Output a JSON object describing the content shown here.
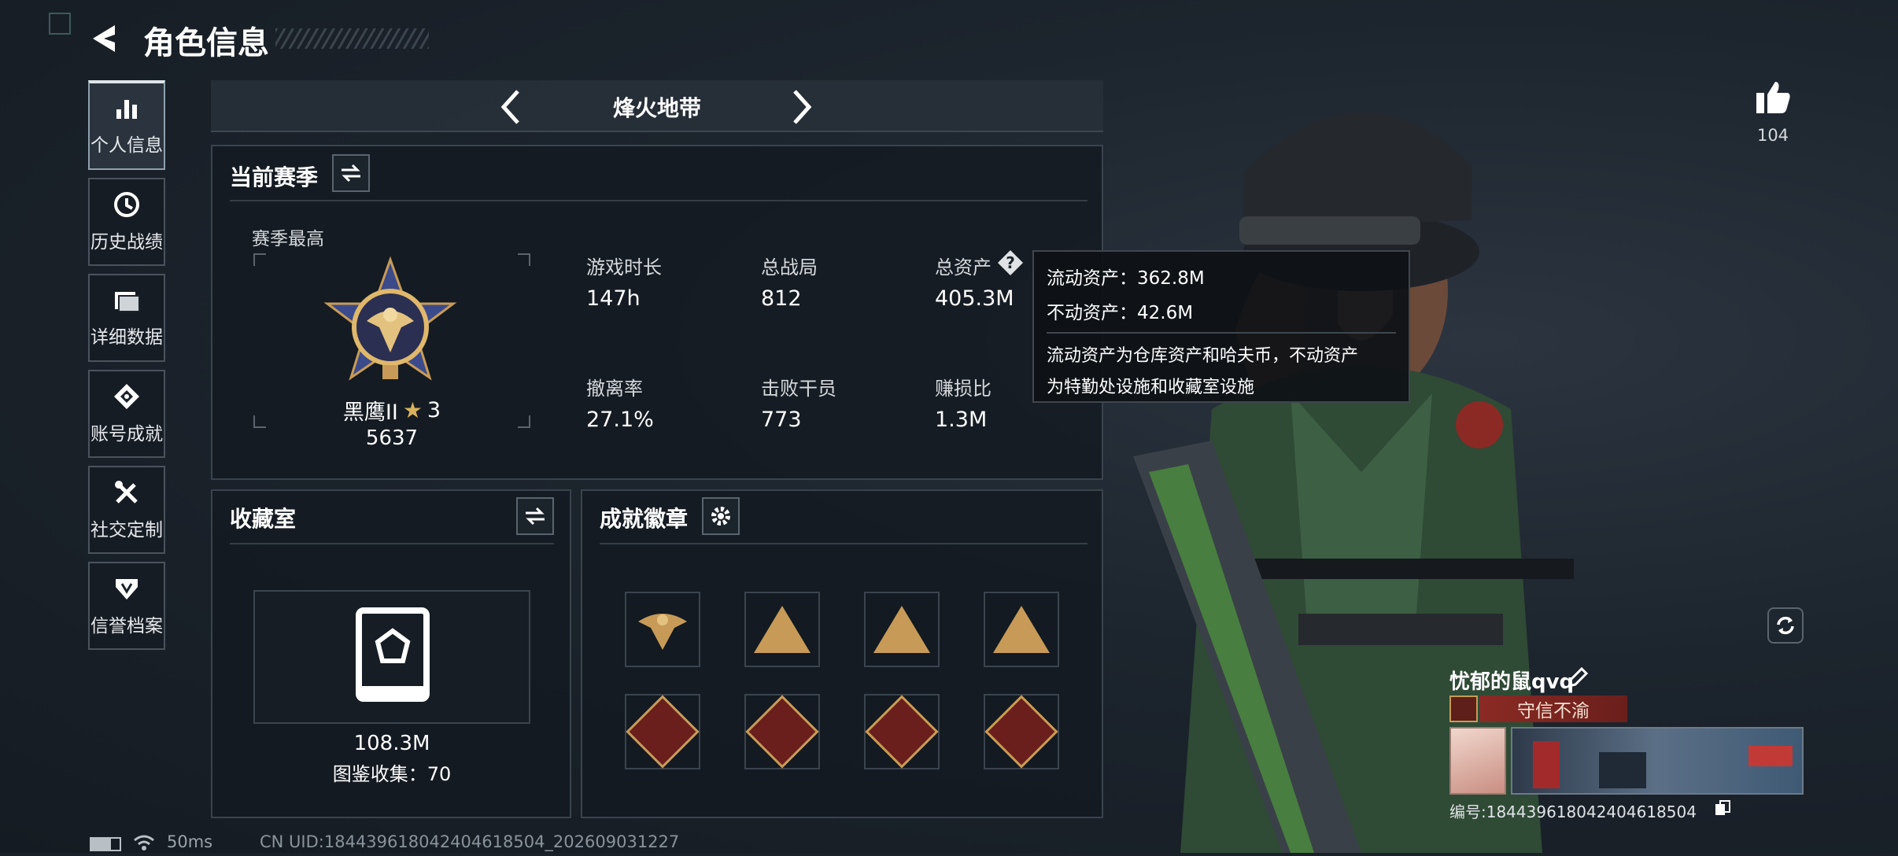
{
  "header": {
    "title": "角色信息"
  },
  "sidebar": {
    "items": [
      {
        "label": "个人信息",
        "icon": "bar-chart-icon"
      },
      {
        "label": "历史战绩",
        "icon": "history-icon"
      },
      {
        "label": "详细数据",
        "icon": "folder-icon"
      },
      {
        "label": "账号成就",
        "icon": "achievement-icon"
      },
      {
        "label": "社交定制",
        "icon": "tools-icon"
      },
      {
        "label": "信誉档案",
        "icon": "credit-icon"
      }
    ]
  },
  "mode_tabs": {
    "current": "烽火地带"
  },
  "season": {
    "title": "当前赛季",
    "best_label": "赛季最高",
    "rank_name": "黑鹰II",
    "rank_stars": "3",
    "rank_score": "5637",
    "stats": [
      {
        "label": "游戏时长",
        "value": "147h"
      },
      {
        "label": "总战局",
        "value": "812"
      },
      {
        "label": "总资产",
        "value": "405.3M"
      },
      {
        "label": "撤离率",
        "value": "27.1%"
      },
      {
        "label": "击败干员",
        "value": "773"
      },
      {
        "label": "赚损比",
        "value": "1.3M"
      }
    ]
  },
  "tooltip": {
    "liquid": "流动资产：362.8M",
    "fixed": "不动资产：42.6M",
    "desc_line1": "流动资产为仓库资产和哈夫币，不动资产",
    "desc_line2": "为特勤处设施和收藏室设施"
  },
  "collection": {
    "title": "收藏室",
    "value": "108.3M",
    "count_text": "图鉴收集：70"
  },
  "achievements": {
    "title": "成就徽章",
    "badge_count": 8
  },
  "like": {
    "count": "104"
  },
  "player": {
    "name": "忧郁的鼠qvq",
    "reputation_tag": "守信不渝",
    "id_text": "编号:18443961804240461850​4"
  },
  "status_bar": {
    "latency": "50ms",
    "uid_text": "CN UID:18443961804240461850​4_202609031227"
  },
  "colors": {
    "accent_red": "#8b2a24",
    "gold": "#c79b57",
    "panel_border": "#3a434d"
  }
}
